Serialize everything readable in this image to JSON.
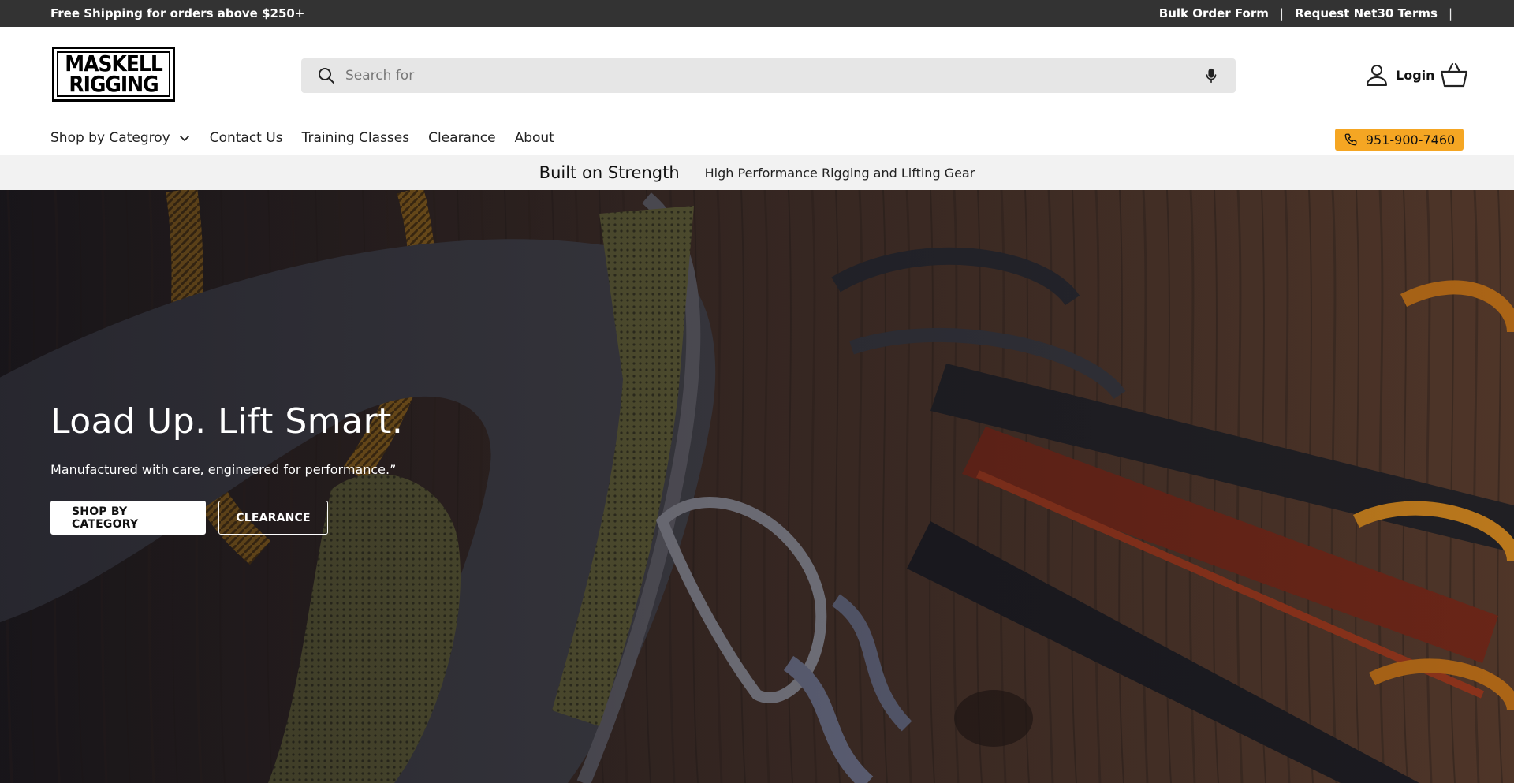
{
  "announcement": {
    "left_text": "Free Shipping for orders above $250+",
    "links": [
      "Bulk Order Form",
      "Request Net30 Terms"
    ],
    "separator": "|"
  },
  "logo": {
    "line1": "MASKELL",
    "line2": "RIGGING"
  },
  "search": {
    "placeholder": "Search for"
  },
  "account": {
    "login_label": "Login"
  },
  "nav": {
    "items": [
      {
        "label": "Shop by Categroy",
        "has_dropdown": true
      },
      {
        "label": "Contact Us"
      },
      {
        "label": "Training Classes"
      },
      {
        "label": "Clearance"
      },
      {
        "label": "About"
      }
    ],
    "phone": "951-900-7460"
  },
  "strip": {
    "headline": "Built on Strength",
    "subline": "High Performance Rigging and Lifting Gear"
  },
  "hero": {
    "title": "Load Up. Lift Smart.",
    "subtitle": "Manufactured with care, engineered for performance.”",
    "primary_button": "SHOP BY CATEGORY",
    "secondary_button": "CLEARANCE"
  },
  "colors": {
    "announce_bg": "#333333",
    "phone_bg": "#f5a623",
    "search_bg": "#e6e6e6",
    "strip_bg": "#f2f2f2"
  },
  "icons": [
    "search-icon",
    "mic-icon",
    "user-icon",
    "cart-icon",
    "chevron-down-icon",
    "phone-icon"
  ]
}
